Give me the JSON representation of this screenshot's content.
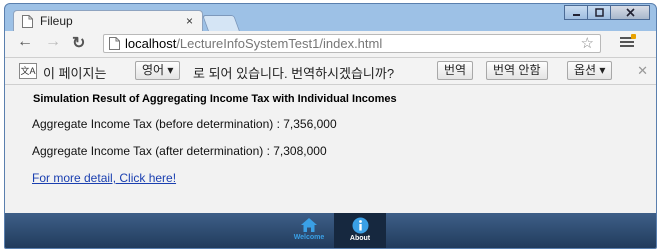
{
  "window": {
    "tab_title": "Fileup",
    "tab_close": "×"
  },
  "toolbar": {
    "url_host": "localhost",
    "url_path": "/LectureInfoSystemTest1/index.html"
  },
  "translate_bar": {
    "prefix": "이 페이지는",
    "language": "영어",
    "message": "로 되어 있습니다. 번역하시겠습니까?",
    "translate_button": "번역",
    "no_translate_button": "번역 안함",
    "options_button": "옵션"
  },
  "content": {
    "heading": "Simulation Result of Aggregating Income Tax with Individual Incomes",
    "line_before": "Aggregate Income Tax (before determination) : 7,356,000",
    "line_after": "Aggregate Income Tax (after determination) : 7,308,000",
    "detail_link": "For more detail, Click here!"
  },
  "footer_nav": {
    "welcome_label": "Welcome",
    "about_label": "About",
    "welcome_color": "#3aa0e6",
    "active": "About"
  },
  "colors": {
    "footer_bar": "#213b5c",
    "link": "#1a3fb0",
    "window_frame": "#9dc1e6"
  }
}
